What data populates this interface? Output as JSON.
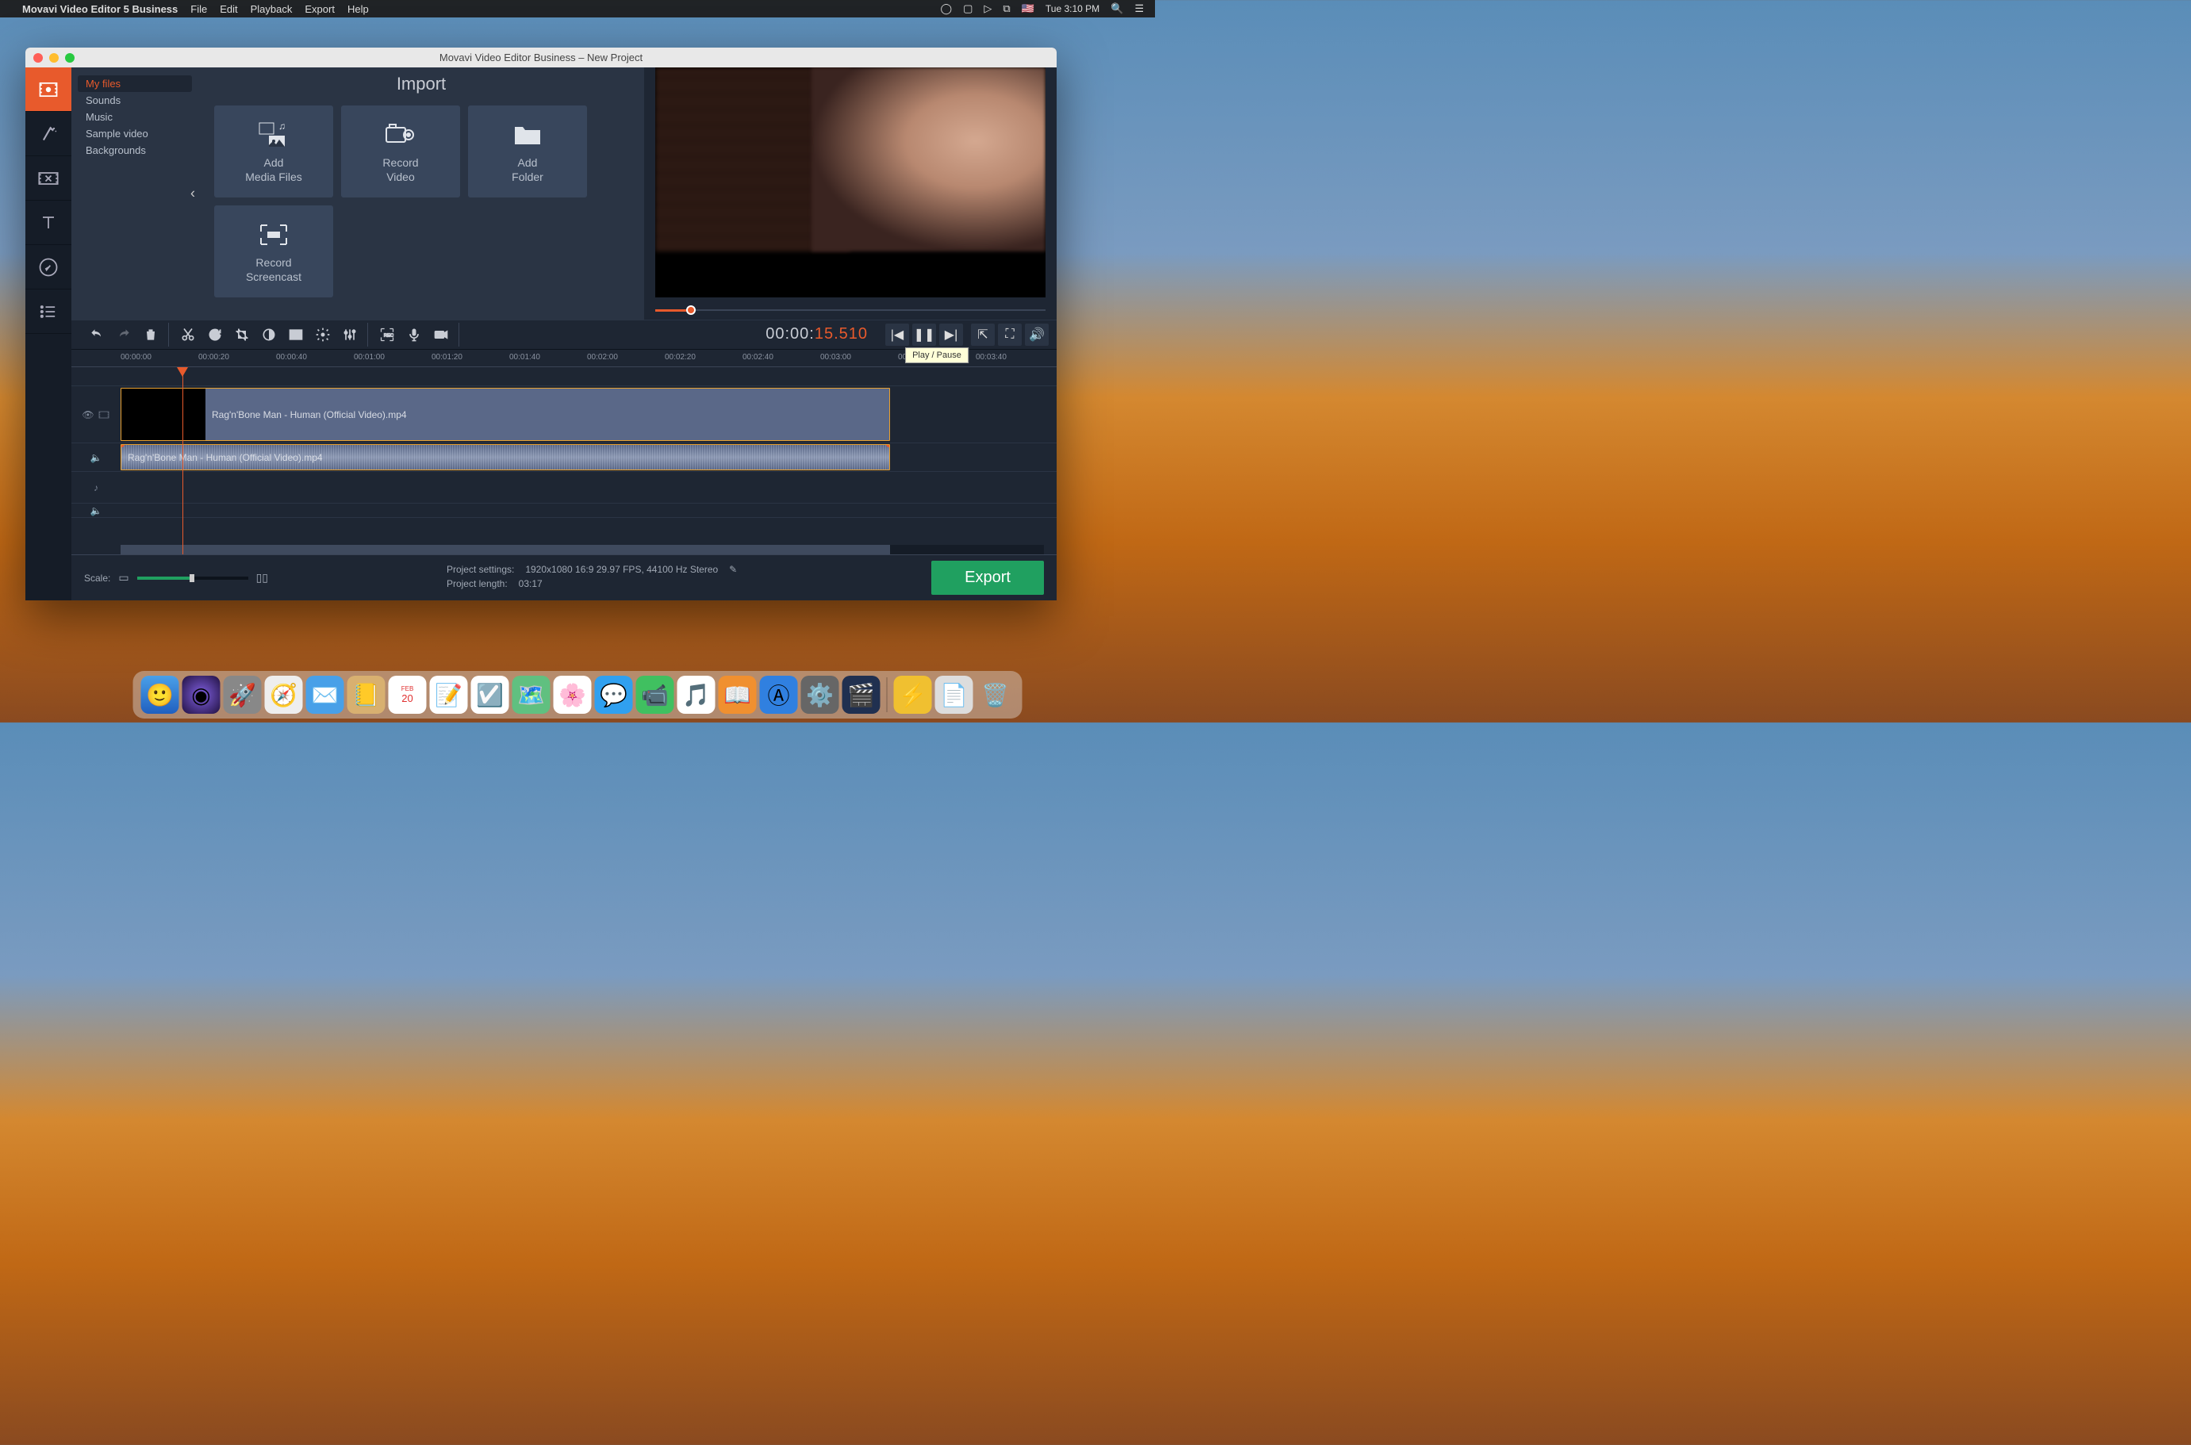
{
  "menubar": {
    "app_name": "Movavi Video Editor 5 Business",
    "items": [
      "File",
      "Edit",
      "Playback",
      "Export",
      "Help"
    ],
    "clock": "Tue 3:10 PM"
  },
  "window": {
    "title": "Movavi Video Editor Business – New Project"
  },
  "import": {
    "title": "Import",
    "categories": [
      "My files",
      "Sounds",
      "Music",
      "Sample video",
      "Backgrounds"
    ],
    "cards": {
      "add_media": "Add\nMedia Files",
      "record_video": "Record\nVideo",
      "add_folder": "Add\nFolder",
      "record_screencast": "Record\nScreencast"
    }
  },
  "playback": {
    "timecode_prefix": "00:00:",
    "timecode_highlight": "15.510",
    "tooltip": "Play / Pause"
  },
  "ruler": {
    "ticks": [
      "00:00:00",
      "00:00:20",
      "00:00:40",
      "00:01:00",
      "00:01:20",
      "00:01:40",
      "00:02:00",
      "00:02:20",
      "00:02:40",
      "00:03:00",
      "00:03:20",
      "00:03:40"
    ]
  },
  "clips": {
    "video_name": "Rag'n'Bone Man - Human (Official Video).mp4",
    "audio_name": "Rag'n'Bone Man - Human (Official Video).mp4"
  },
  "status": {
    "scale_label": "Scale:",
    "settings_label": "Project settings:",
    "settings_value": "1920x1080 16:9 29.97 FPS, 44100 Hz Stereo",
    "length_label": "Project length:",
    "length_value": "03:17",
    "export": "Export"
  }
}
